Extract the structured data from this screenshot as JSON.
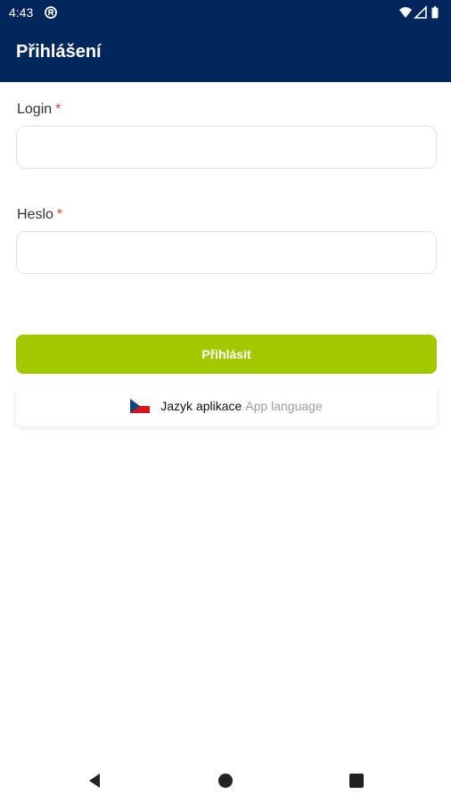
{
  "status_bar": {
    "time": "4:43",
    "icons": [
      "app-notification-icon",
      "wifi-icon",
      "signal-icon",
      "battery-icon"
    ]
  },
  "app_bar": {
    "title": "Přihlášení",
    "background": "#03275c"
  },
  "form": {
    "login": {
      "label": "Login",
      "required_mark": "*",
      "value": "",
      "placeholder": ""
    },
    "password": {
      "label": "Heslo",
      "required_mark": "*",
      "value": "",
      "placeholder": ""
    },
    "submit_label": "Přihlásit",
    "submit_color": "#a2c900"
  },
  "language": {
    "label": "Jazyk aplikace",
    "sublabel": "App language",
    "flag": "czech-flag-icon"
  },
  "nav_bar": {
    "buttons": [
      "back-icon",
      "home-icon",
      "recents-icon"
    ]
  }
}
